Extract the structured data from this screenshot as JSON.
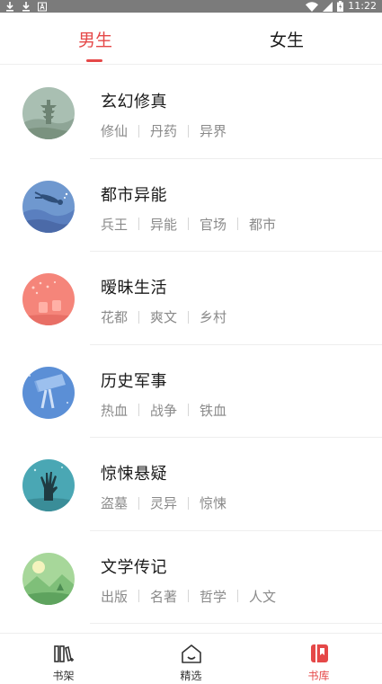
{
  "status_bar": {
    "time": "11:22",
    "left_icons": [
      "download-icon",
      "download-icon",
      "app-a-icon"
    ],
    "right_icons": [
      "wifi-icon",
      "signal-icon",
      "battery-icon"
    ]
  },
  "tabs": [
    {
      "label": "男生",
      "active": true
    },
    {
      "label": "女生",
      "active": false
    }
  ],
  "categories": [
    {
      "title": "玄幻修真",
      "icon": "pagoda-icon",
      "tags": [
        "修仙",
        "丹药",
        "异界"
      ]
    },
    {
      "title": "都市异能",
      "icon": "diver-icon",
      "tags": [
        "兵王",
        "异能",
        "官场",
        "都市"
      ]
    },
    {
      "title": "暧昧生活",
      "icon": "flowers-icon",
      "tags": [
        "花都",
        "爽文",
        "乡村"
      ]
    },
    {
      "title": "历史军事",
      "icon": "telescope-icon",
      "tags": [
        "热血",
        "战争",
        "铁血"
      ]
    },
    {
      "title": "惊悚悬疑",
      "icon": "zombie-hand-icon",
      "tags": [
        "盗墓",
        "灵异",
        "惊悚"
      ]
    },
    {
      "title": "文学传记",
      "icon": "landscape-icon",
      "tags": [
        "出版",
        "名著",
        "哲学",
        "人文"
      ]
    }
  ],
  "bottom_nav": [
    {
      "label": "书架",
      "icon": "bookshelf-icon",
      "active": false
    },
    {
      "label": "精选",
      "icon": "home-icon",
      "active": false
    },
    {
      "label": "书库",
      "icon": "library-icon",
      "active": true
    }
  ],
  "colors": {
    "accent": "#e54848",
    "tag_text": "#8a8a8a",
    "status_bar": "#7b7b7b"
  }
}
